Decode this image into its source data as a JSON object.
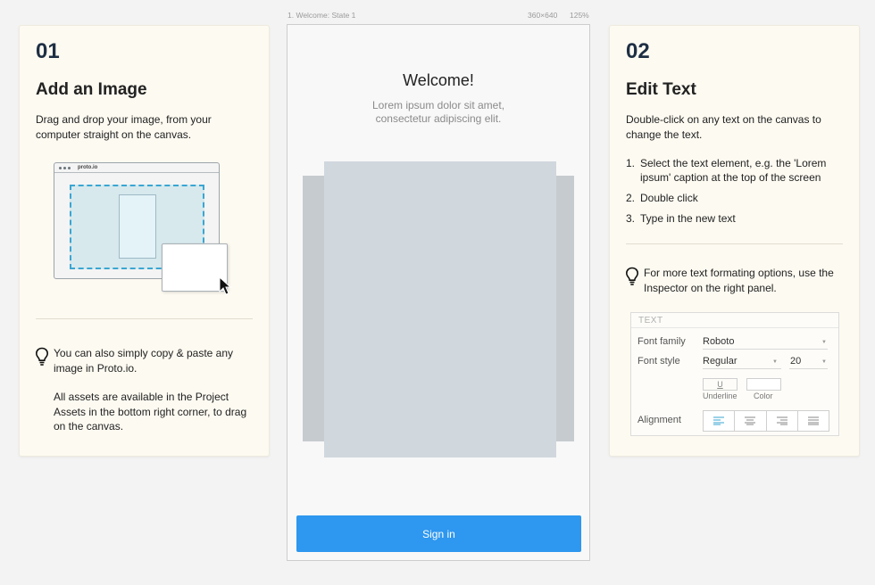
{
  "left_card": {
    "number": "01",
    "title": "Add an Image",
    "description": "Drag and drop your image, from your computer straight on the canvas.",
    "illustration_brand": "proto.io",
    "tip_line1": "You can also simply copy & paste any image in Proto.io.",
    "tip_line2": "All assets are available in the Project Assets in the bottom right corner, to drag on the canvas."
  },
  "phone": {
    "label": "1. Welcome: State 1",
    "size_label": "360×640",
    "zoom_label": "125%",
    "welcome_title": "Welcome!",
    "subtitle_line1": "Lorem ipsum dolor sit amet,",
    "subtitle_line2": "consectetur adipiscing elit.",
    "signin_label": "Sign in",
    "signin_color": "#2e97ef"
  },
  "right_card": {
    "number": "02",
    "title": "Edit Text",
    "description": "Double-click on any text on the canvas to change the text.",
    "steps": [
      {
        "num": "1.",
        "text": "Select the text element, e.g. the 'Lorem ipsum' caption at the top of the screen"
      },
      {
        "num": "2.",
        "text": "Double click"
      },
      {
        "num": "3.",
        "text": "Type in the new text"
      }
    ],
    "tip": "For more text formating options, use the Inspector on the right panel.",
    "inspector": {
      "header": "TEXT",
      "font_family_label": "Font family",
      "font_family_value": "Roboto",
      "font_style_label": "Font style",
      "font_style_value": "Regular",
      "font_size_value": "20",
      "underline_symbol": "U",
      "underline_label": "Underline",
      "color_label": "Color",
      "alignment_label": "Alignment"
    }
  },
  "colors": {
    "card_background": "#fdfaf1",
    "heading_navy": "#1e2f44",
    "accent_blue": "#3aa6d2"
  }
}
